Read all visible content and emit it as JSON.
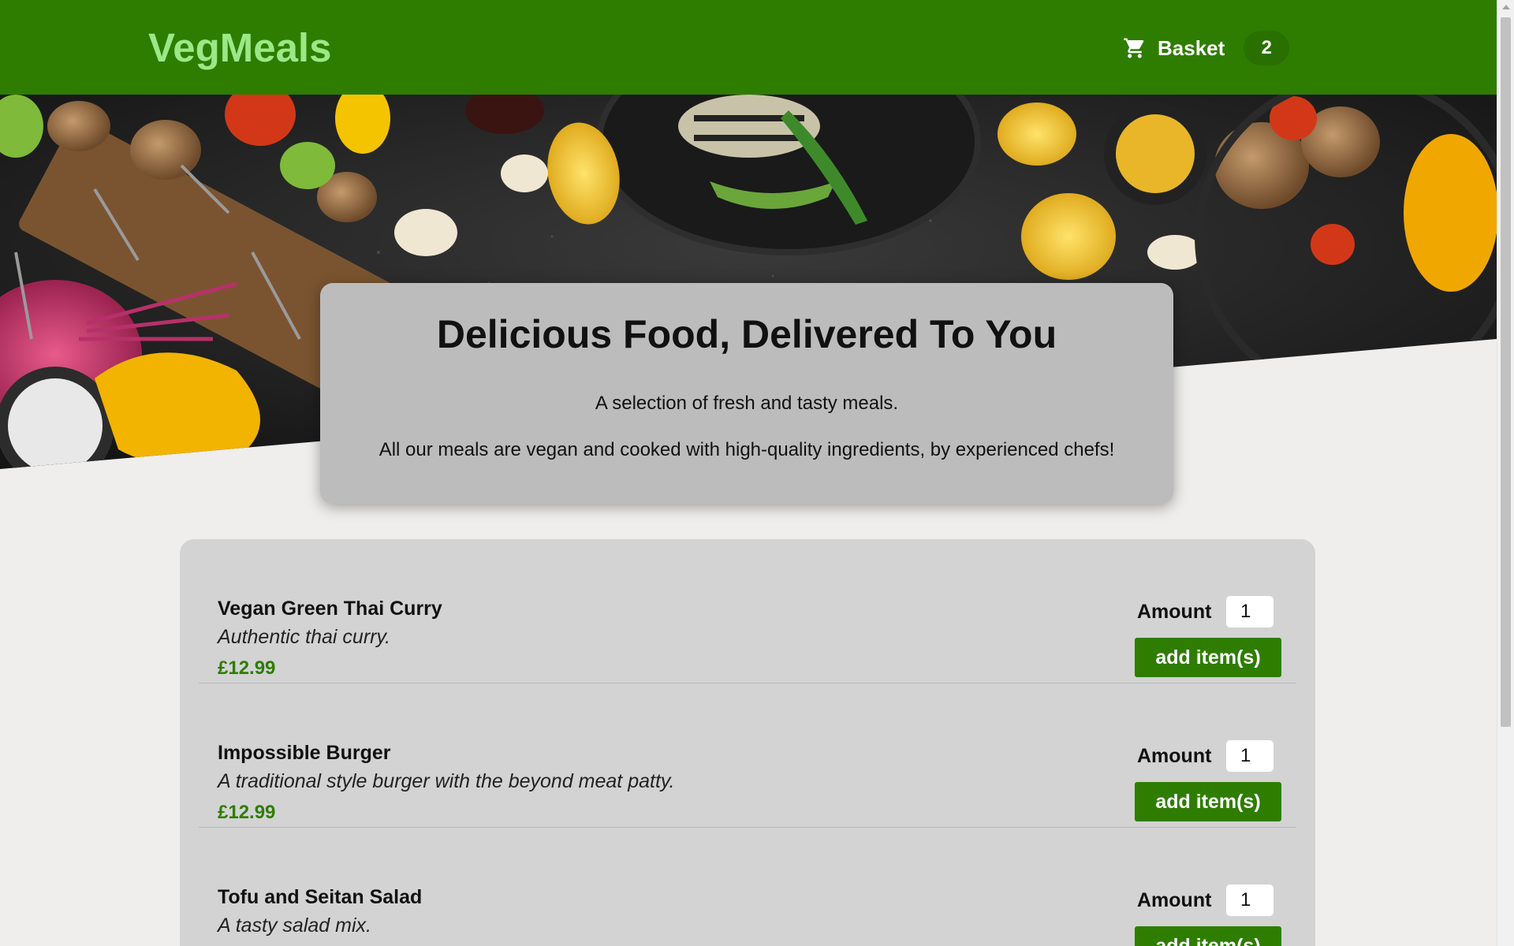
{
  "header": {
    "logo": "VegMeals",
    "basket_label": "Basket",
    "basket_count": "2",
    "cart_icon": "cart-icon"
  },
  "summary": {
    "title": "Delicious Food, Delivered To You",
    "line1": "A selection of fresh and tasty meals.",
    "line2": "All our meals are vegan and cooked with high-quality ingredients, by experienced chefs!"
  },
  "meals": [
    {
      "name": "Vegan Green Thai Curry",
      "description": "Authentic thai curry.",
      "price": "£12.99",
      "amount_label": "Amount",
      "amount_value": "1",
      "button_label": "add item(s)"
    },
    {
      "name": "Impossible Burger",
      "description": "A traditional style burger with the beyond meat patty.",
      "price": "£12.99",
      "amount_label": "Amount",
      "amount_value": "1",
      "button_label": "add item(s)"
    },
    {
      "name": "Tofu and Seitan Salad",
      "description": "A tasty salad mix.",
      "price": "",
      "amount_label": "Amount",
      "amount_value": "1",
      "button_label": "add item(s)"
    }
  ],
  "colors": {
    "brand_green": "#2e7d00",
    "logo_green": "#9be887",
    "page_bg": "#efeeec",
    "card_bg": "#d3d3d3"
  }
}
